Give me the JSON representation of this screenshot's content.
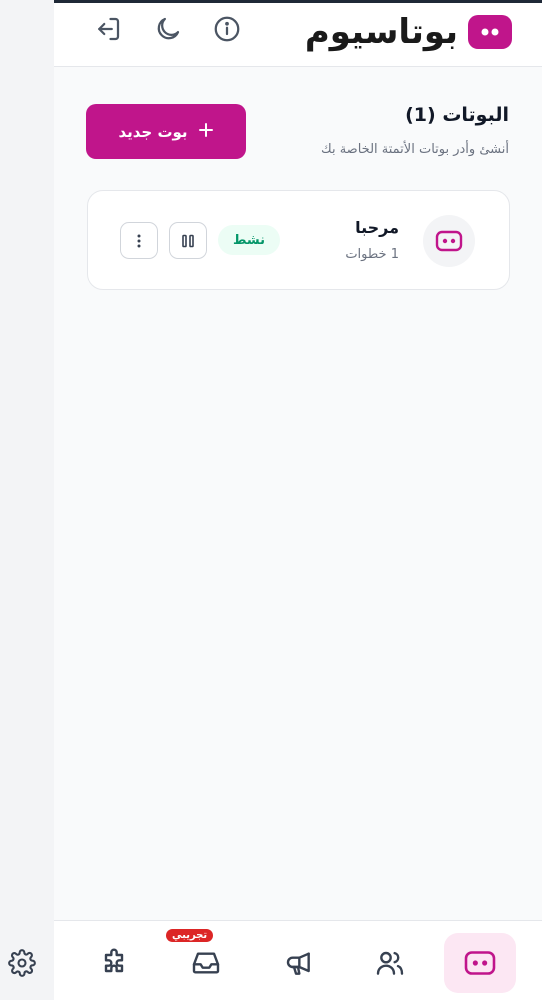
{
  "header": {
    "brand_name": "بوتاسيوم",
    "icons": [
      "logout-icon",
      "moon-icon",
      "info-icon"
    ]
  },
  "page": {
    "title": "البوتات (1)",
    "subtitle": "أنشئ وأدر بوتات الأتمتة الخاصة بك",
    "new_bot_label": "بوت جديد"
  },
  "bots": [
    {
      "name": "مرحبا",
      "steps": "1 خطوات",
      "status": "نشط"
    }
  ],
  "bottom_nav": {
    "items": [
      "bots-icon",
      "users-icon",
      "megaphone-icon",
      "inbox-icon",
      "puzzle-icon"
    ],
    "trial_badge": "تجريبي"
  },
  "colors": {
    "brand": "#c0158b",
    "status_green": "#059669",
    "status_bg": "#ecfdf5"
  }
}
